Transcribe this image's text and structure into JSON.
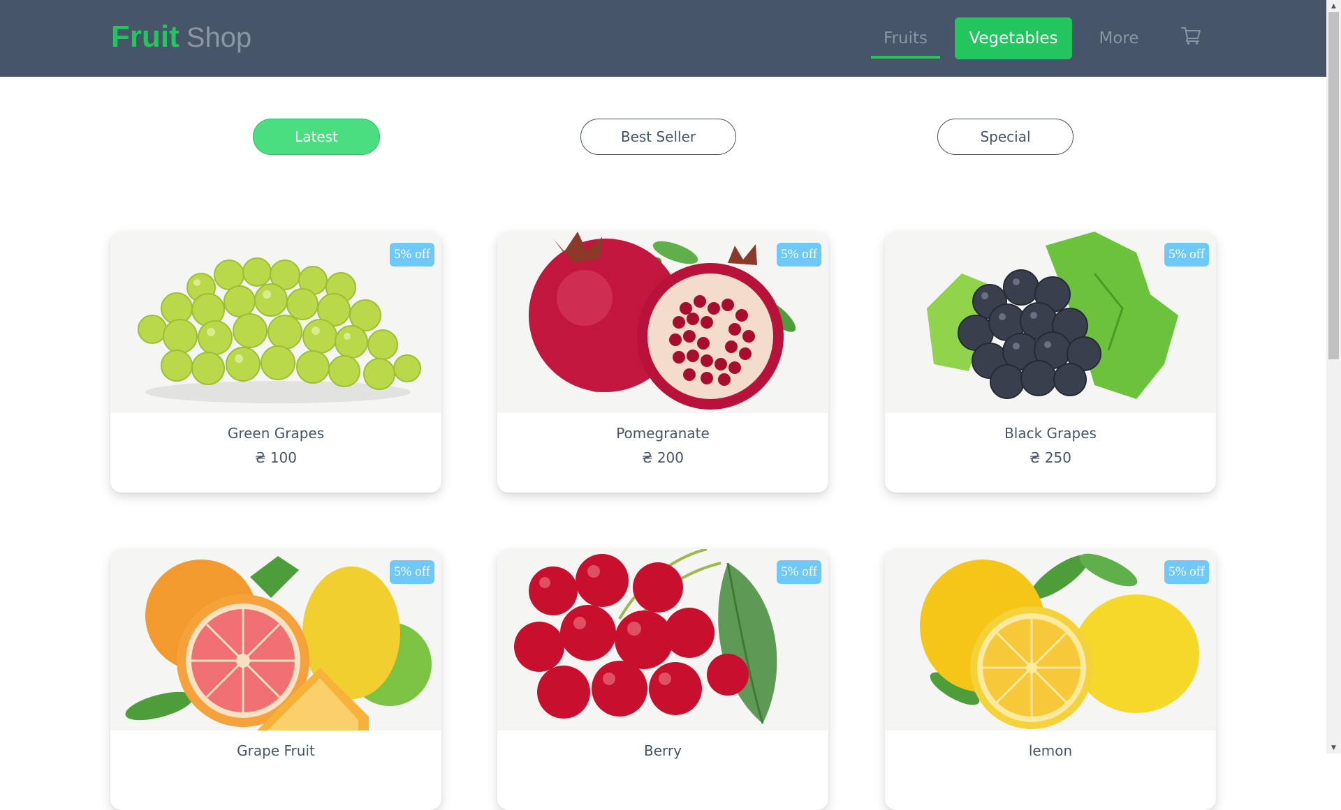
{
  "header": {
    "brand_main": "Fruit",
    "brand_sub": "Shop",
    "nav": {
      "fruits": "Fruits",
      "vegetables": "Vegetables",
      "more": "More",
      "cart_icon": "cart-icon"
    }
  },
  "filters": {
    "latest": "Latest",
    "best_seller": "Best Seller",
    "special": "Special",
    "active": "Latest"
  },
  "products": [
    {
      "name": "Green Grapes",
      "price": "₴ 100",
      "badge": "5% off"
    },
    {
      "name": "Pomegranate",
      "price": "₴ 200",
      "badge": "5% off"
    },
    {
      "name": "Black Grapes",
      "price": "₴ 250",
      "badge": "5% off"
    },
    {
      "name": "Grape Fruit",
      "price": "",
      "badge": "5% off"
    },
    {
      "name": "Berry",
      "price": "",
      "badge": "5% off"
    },
    {
      "name": "lemon",
      "price": "",
      "badge": "5% off"
    }
  ],
  "colors": {
    "header_bg": "#475569",
    "accent": "#22c55e",
    "badge": "#6ec9f7",
    "text": "#475569"
  }
}
